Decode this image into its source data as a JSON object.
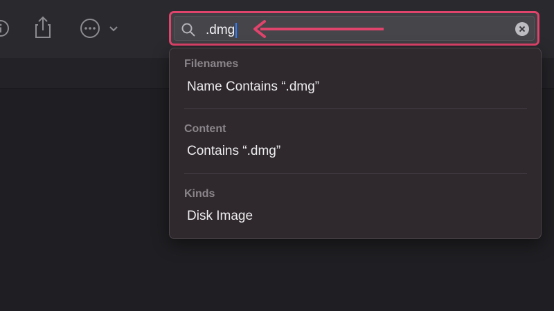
{
  "toolbar": {
    "icons": [
      "info-icon",
      "share-icon",
      "more-icon",
      "chevron-down-icon"
    ]
  },
  "search": {
    "value": ".dmg",
    "icon": "search-icon",
    "clear_icon": "clear-icon",
    "highlight_color": "#e0436b",
    "caret_color": "#2f7df6"
  },
  "dropdown": {
    "sections": [
      {
        "header": "Filenames",
        "item": "Name Contains “.dmg”"
      },
      {
        "header": "Content",
        "item": "Contains “.dmg”"
      },
      {
        "header": "Kinds",
        "item": "Disk Image"
      }
    ]
  }
}
